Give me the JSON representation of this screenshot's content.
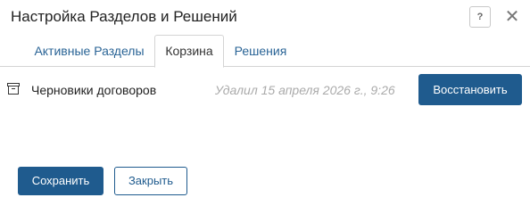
{
  "dialog": {
    "title": "Настройка Разделов и Решений",
    "help_label": "?",
    "close_label": "✕"
  },
  "tabs": [
    {
      "label": "Активные Разделы",
      "active": false
    },
    {
      "label": "Корзина",
      "active": true
    },
    {
      "label": "Решения",
      "active": false
    }
  ],
  "trash": {
    "items": [
      {
        "icon": "archive-box-icon",
        "name": "Черновики договоров",
        "deleted_text": "Удалил 15 апреля 2026 г., 9:26",
        "restore_label": "Восстановить"
      }
    ]
  },
  "footer": {
    "save_label": "Сохранить",
    "close_label": "Закрыть"
  },
  "colors": {
    "primary": "#1f5b8e",
    "link": "#2a6496",
    "muted": "#aaaaaa"
  }
}
